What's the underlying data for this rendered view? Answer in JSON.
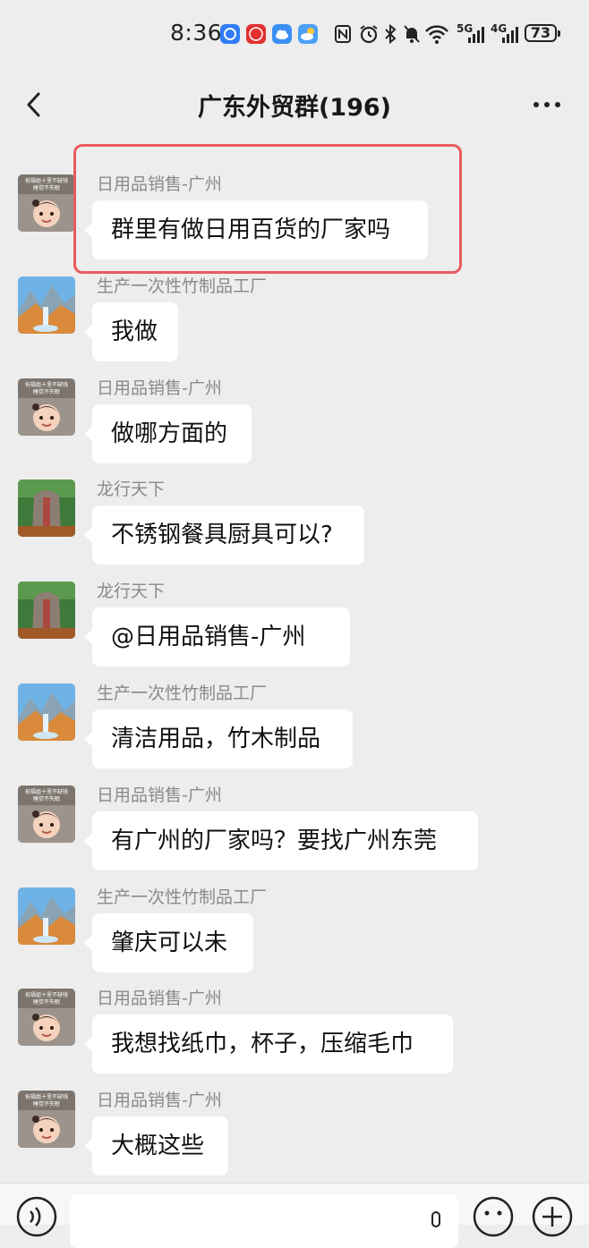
{
  "status_bar": {
    "time": "8:36",
    "network_label_1": "5G",
    "network_label_2": "4G",
    "battery": "73",
    "icons": [
      "app-blue-icon",
      "app-red-icon",
      "cloud-icon",
      "weather-icon",
      "nfc-icon",
      "alarm-icon",
      "bluetooth-icon",
      "mute-icon",
      "wifi-icon",
      "signal-icon",
      "signal-icon",
      "battery-icon"
    ]
  },
  "header": {
    "title": "广东外贸群(196)"
  },
  "messages": [
    {
      "sender": "日用品销售-广州",
      "text": "群里有做日用百货的厂家吗",
      "avatar": "baby"
    },
    {
      "sender": "生产一次性竹制品工厂",
      "text": "我做",
      "avatar": "landscape"
    },
    {
      "sender": "日用品销售-广州",
      "text": "做哪方面的",
      "avatar": "baby"
    },
    {
      "sender": "龙行天下",
      "text": "不锈钢餐具厨具可以?",
      "avatar": "stone"
    },
    {
      "sender": "龙行天下",
      "text": "@日用品销售-广州",
      "avatar": "stone"
    },
    {
      "sender": "生产一次性竹制品工厂",
      "text": "清洁用品，竹木制品",
      "avatar": "landscape"
    },
    {
      "sender": "日用品销售-广州",
      "text": "有广州的厂家吗？要找广州东莞",
      "avatar": "baby"
    },
    {
      "sender": "生产一次性竹制品工厂",
      "text": "肇庆可以未",
      "avatar": "landscape"
    },
    {
      "sender": "日用品销售-广州",
      "text": "我想找纸巾，杯子，压缩毛巾",
      "avatar": "baby"
    },
    {
      "sender": "日用品销售-广州",
      "text": "大概这些",
      "avatar": "baby"
    }
  ],
  "avatar_caption": {
    "line1": "祝福姐十里不缺钱",
    "line2": "睡觉不失眠"
  },
  "colors": {
    "background": "#ededed",
    "bubble": "#ffffff",
    "highlight_border": "#e95b5b",
    "sender_text": "#8a8a8a"
  }
}
